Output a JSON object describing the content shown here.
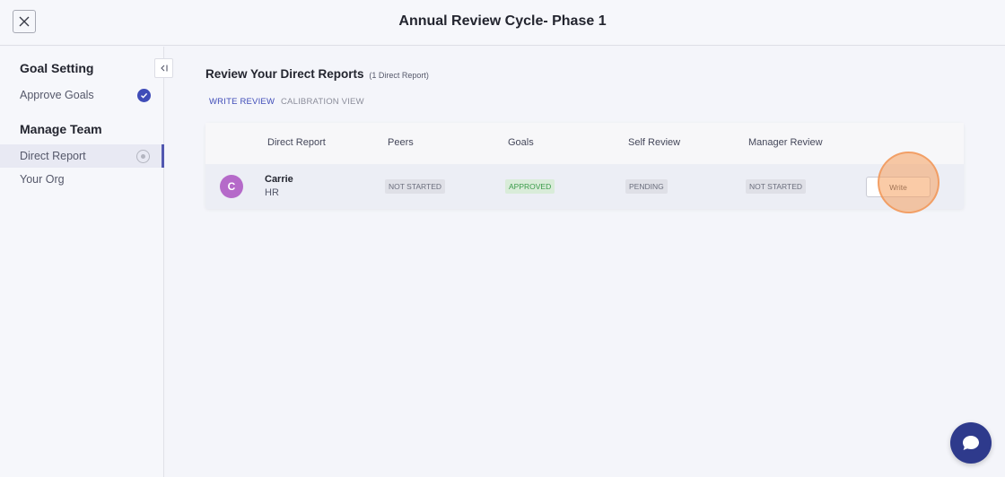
{
  "header": {
    "title": "Annual Review Cycle- Phase 1"
  },
  "sidebar": {
    "goal_setting": {
      "heading": "Goal Setting",
      "items": [
        {
          "label": "Approve Goals"
        }
      ]
    },
    "manage_team": {
      "heading": "Manage Team",
      "items": [
        {
          "label": "Direct Report"
        },
        {
          "label": "Your Org"
        }
      ]
    }
  },
  "main": {
    "title": "Review Your Direct Reports",
    "subtitle": "(1 Direct Report)",
    "tabs": [
      {
        "label": "WRITE REVIEW"
      },
      {
        "label": "CALIBRATION VIEW"
      }
    ],
    "table": {
      "columns": [
        "Direct Report",
        "Peers",
        "Goals",
        "Self Review",
        "Manager Review"
      ],
      "rows": [
        {
          "initial": "C",
          "name": "Carrie",
          "department": "HR",
          "peers": "NOT STARTED",
          "goals": "APPROVED",
          "self_review": "PENDING",
          "manager_review": "NOT STARTED",
          "action": "Write"
        }
      ]
    }
  },
  "colors": {
    "accent": "#3f4cb8",
    "avatar": "#b56ac9",
    "approved": "#3a9b4a",
    "chat": "#2e3a8c"
  }
}
